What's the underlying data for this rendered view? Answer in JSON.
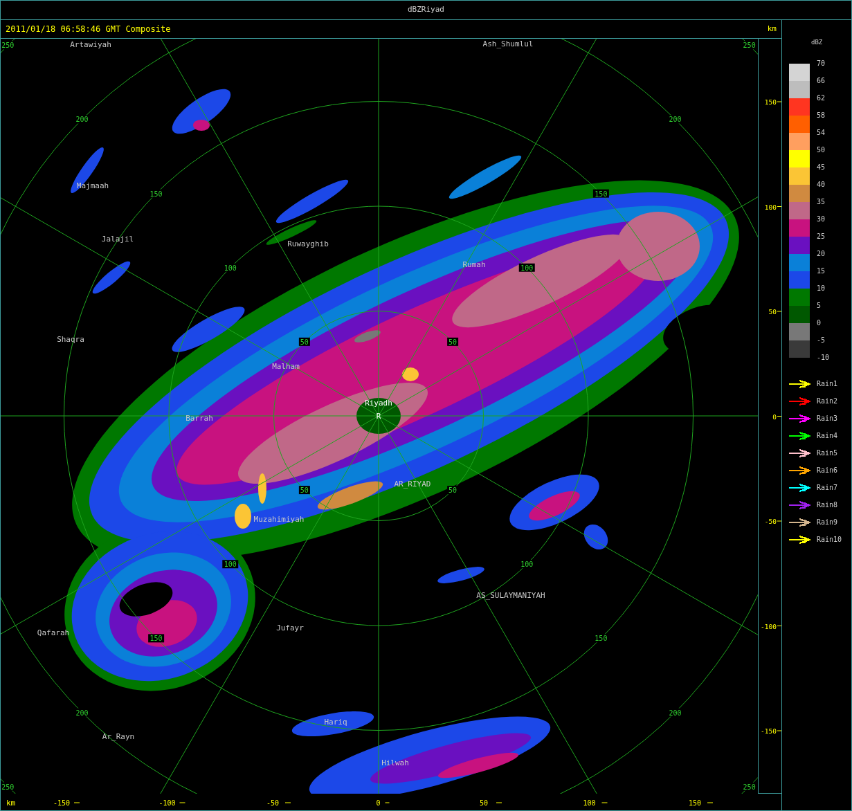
{
  "window": {
    "title": "dBZRiyad"
  },
  "header": {
    "timestamp": "2011/01/18 06:58:46 GMT Composite",
    "unit": "km"
  },
  "map": {
    "range_rings": [
      {
        "labels": [
          "50",
          "50",
          "50",
          "50"
        ]
      },
      {
        "labels": [
          "100",
          "100",
          "100",
          "100"
        ]
      },
      {
        "labels": [
          "150",
          "150",
          "150",
          "150"
        ]
      },
      {
        "labels": [
          "200",
          "200",
          "200",
          "200"
        ]
      },
      {
        "labels": [
          "250",
          "250",
          "250",
          "250"
        ]
      }
    ],
    "places": [
      {
        "name": "Artawiyah",
        "kind": "city"
      },
      {
        "name": "Ash_Shumlul",
        "kind": "city"
      },
      {
        "name": "Majmaah",
        "kind": "city"
      },
      {
        "name": "Jalajil",
        "kind": "city"
      },
      {
        "name": "Ruwayghib",
        "kind": "city"
      },
      {
        "name": "Rumah",
        "kind": "city"
      },
      {
        "name": "Shaqra",
        "kind": "city"
      },
      {
        "name": "Malham",
        "kind": "city"
      },
      {
        "name": "Riyadh",
        "kind": "radar"
      },
      {
        "name": "R",
        "kind": "radar"
      },
      {
        "name": "Barrah",
        "kind": "city"
      },
      {
        "name": "AR_RIYAD",
        "kind": "city"
      },
      {
        "name": "Muzahimiyah",
        "kind": "city"
      },
      {
        "name": "AS_SULAYMANIYAH",
        "kind": "city"
      },
      {
        "name": "Qafarah",
        "kind": "city"
      },
      {
        "name": "Jufayr",
        "kind": "city"
      },
      {
        "name": "Hariq",
        "kind": "city"
      },
      {
        "name": "Ar_Rayn",
        "kind": "city"
      },
      {
        "name": "Hilwah",
        "kind": "city"
      }
    ]
  },
  "y_axis": {
    "ticks": [
      "150",
      "100",
      "50",
      "0",
      "-50",
      "-100",
      "-150"
    ]
  },
  "x_axis": {
    "unit": "km",
    "ticks": [
      "-150",
      "-100",
      "-50",
      "0",
      "50",
      "100",
      "150"
    ]
  },
  "legend": {
    "title": "dBZ",
    "swatches": [
      {
        "color": "#d4d4d4"
      },
      {
        "color": "#bdbdbd"
      },
      {
        "color": "#ff3520"
      },
      {
        "color": "#ff5f00"
      },
      {
        "color": "#ff9f5f"
      },
      {
        "color": "#ffff00"
      },
      {
        "color": "#fbc535"
      },
      {
        "color": "#d08a40"
      },
      {
        "color": "#c06888"
      },
      {
        "color": "#c8127f"
      },
      {
        "color": "#6a10c0"
      },
      {
        "color": "#0a80d8"
      },
      {
        "color": "#1c48e8"
      },
      {
        "color": "#007800"
      },
      {
        "color": "#005800"
      },
      {
        "color": "#787878"
      },
      {
        "color": "#3a3a3a"
      }
    ],
    "scale_labels": [
      "70",
      "66",
      "62",
      "58",
      "54",
      "50",
      "45",
      "40",
      "35",
      "30",
      "25",
      "20",
      "15",
      "10",
      "5",
      "0",
      "-5",
      "-10"
    ],
    "tracks": [
      {
        "name": "Rain1",
        "color": "#ffff00"
      },
      {
        "name": "Rain2",
        "color": "#ff0000"
      },
      {
        "name": "Rain3",
        "color": "#ff00ff"
      },
      {
        "name": "Rain4",
        "color": "#00ff00"
      },
      {
        "name": "Rain5",
        "color": "#ffc0cb"
      },
      {
        "name": "Rain6",
        "color": "#ffa500"
      },
      {
        "name": "Rain7",
        "color": "#00ffff"
      },
      {
        "name": "Rain8",
        "color": "#a020f0"
      },
      {
        "name": "Rain9",
        "color": "#d2b48c"
      },
      {
        "name": "Rain10",
        "color": "#ffff00"
      }
    ]
  }
}
